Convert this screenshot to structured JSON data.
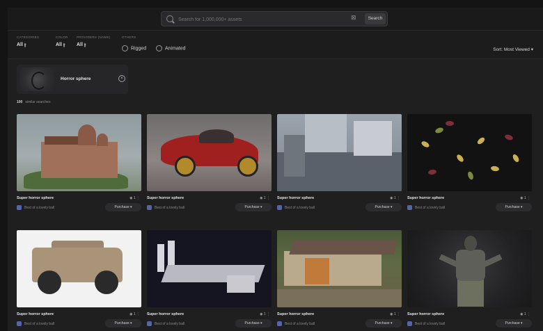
{
  "search": {
    "placeholder": "Search for 1,000,000+ assets",
    "button": "Search"
  },
  "filters": [
    {
      "label": "CATEGORIES",
      "value": "All"
    },
    {
      "label": "COLOR",
      "value": "All"
    },
    {
      "label": "PROVIDERS (NAME)",
      "value": "All"
    },
    {
      "label": "OTHERS",
      "value": ""
    }
  ],
  "filters_extra": {
    "second_value": "All"
  },
  "checkboxes": [
    "Rigged",
    "Animated"
  ],
  "sort": "Sort: Most Viewed",
  "selected": {
    "name": "Horror sphere"
  },
  "similar": {
    "label": "similar searches",
    "count": "100"
  },
  "cards": [
    {
      "title": "Super horror sphere",
      "stat": "1",
      "author": "Best of a lovely ball",
      "button": "Purchase"
    },
    {
      "title": "Super horror sphere",
      "stat": "1",
      "author": "Best of a lovely ball",
      "button": "Purchase"
    },
    {
      "title": "Super horror sphere",
      "stat": "1",
      "author": "Best of a lovely ball",
      "button": "Purchase"
    },
    {
      "title": "Super horror sphere",
      "stat": "1",
      "author": "Best of a lovely ball",
      "button": "Purchase"
    },
    {
      "title": "Super horror sphere",
      "stat": "1",
      "author": "Best of a lovely ball",
      "button": "Purchase"
    },
    {
      "title": "Super horror sphere",
      "stat": "1",
      "author": "Best of a lovely ball",
      "button": "Purchase"
    },
    {
      "title": "Super horror sphere",
      "stat": "1",
      "author": "Best of a lovely ball",
      "button": "Purchase"
    },
    {
      "title": "Super horror sphere",
      "stat": "1",
      "author": "Best of a lovely ball",
      "button": "Purchase"
    }
  ]
}
